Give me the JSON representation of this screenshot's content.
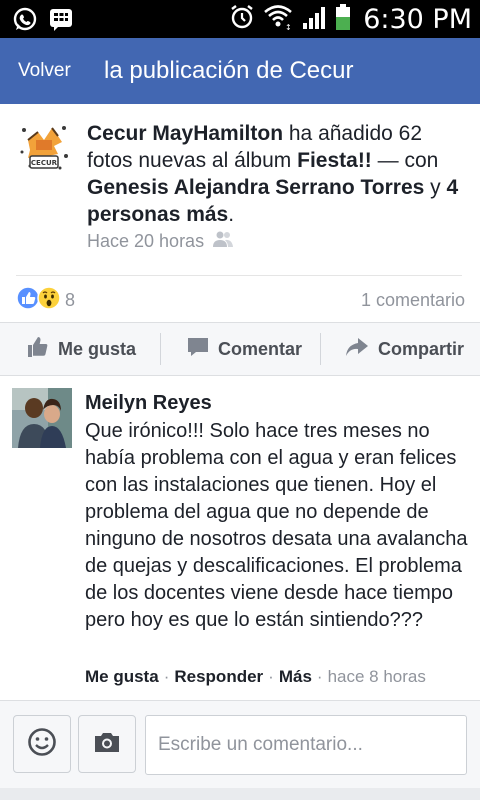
{
  "status_bar": {
    "time": "6:30 PM",
    "left_icons": [
      "whatsapp-icon",
      "bbm-icon"
    ],
    "right_icons": [
      "alarm-icon",
      "wifi-icon",
      "signal-icon",
      "battery-icon"
    ]
  },
  "navbar": {
    "back_label": "Volver",
    "title": "la publicación de Cecur",
    "background": "#4267b2"
  },
  "post": {
    "author": "Cecur MayHamilton",
    "action_text": " ha añadido 62 fotos nuevas al álbum ",
    "album": "Fiesta!!",
    "with_text": " — con ",
    "tagged": "Genesis Alejandra Serrano Torres",
    "and_text": " y ",
    "others": "4 personas más",
    "end_text": ".",
    "time": "Hace 20 horas",
    "audience_icon": "friends-icon",
    "logo_icon": "cecur-logo"
  },
  "reactions": {
    "icons": [
      "like-reaction-icon",
      "wow-reaction-icon"
    ],
    "count": "8",
    "comments": "1 comentario"
  },
  "actions": {
    "like": "Me gusta",
    "comment": "Comentar",
    "share": "Compartir"
  },
  "comment": {
    "author": "Meilyn Reyes",
    "text": "Que irónico!!! Solo hace tres meses no había problema con el agua y eran felices con las instalaciones que tienen. Hoy el problema del agua que no depende de ninguno de nosotros desata una avalancha de quejas y descalificaciones. El problema de los docentes viene desde hace tiempo pero hoy es que lo están sintiendo???",
    "like": "Me gusta",
    "reply": "Responder",
    "more": "Más",
    "time": "hace 8 horas",
    "separator": "·"
  },
  "composer": {
    "placeholder": "Escribe un comentario...",
    "emoji_icon": "emoji-icon",
    "camera_icon": "camera-icon"
  }
}
